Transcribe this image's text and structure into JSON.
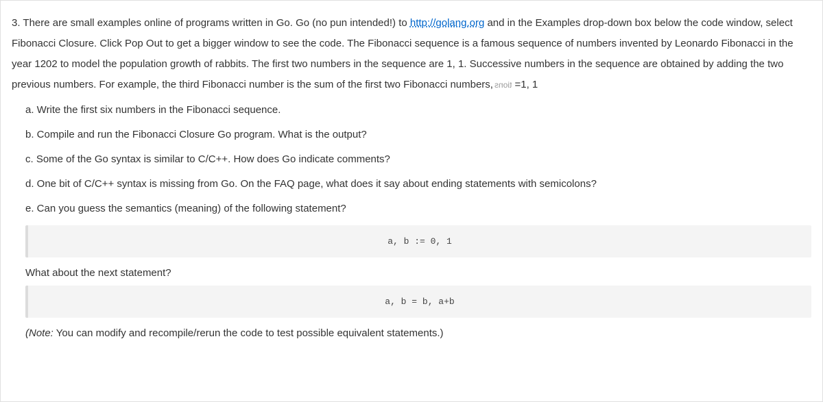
{
  "question": {
    "number": "3.",
    "intro_pre": "There are small examples online of programs written in Go. Go (no pun intended!) to ",
    "link_text": "http://golang.org",
    "link_href": "http://golang.org",
    "intro_post": " and in the Examples drop-down box below the code window, select Fibonacci Closure. Click Pop Out to get a bigger window to see the code. The Fibonacci sequence is a famous sequence of numbers invented by Leonardo Fibonacci in the year 1202 to model the population growth of rabbits. The first two numbers in the sequence are 1, 1. Successive numbers in the sequence are obtained by adding the two previous numbers. For example, the third Fibonacci number is the sum of the first two Fibonacci numbers,",
    "watermark": "tions",
    "tail": " =1, 1"
  },
  "items": {
    "a": "a. Write the first six numbers in the Fibonacci sequence.",
    "b": "b. Compile and run the Fibonacci Closure Go program. What is the output?",
    "c": "c. Some of the Go syntax is similar to C/C++. How does Go indicate comments?",
    "d": "d. One bit of C/C++ syntax is missing from Go. On the FAQ page, what does it say about ending statements with semicolons?",
    "e": "e. Can you guess the semantics (meaning) of the following statement?"
  },
  "code": {
    "first": "a, b := 0, 1",
    "second": "a, b = b, a+b"
  },
  "follow": "What about the next statement?",
  "note": {
    "label": "(Note:",
    "body": " You can modify and recompile/rerun the code to test possible equivalent statements.)"
  }
}
